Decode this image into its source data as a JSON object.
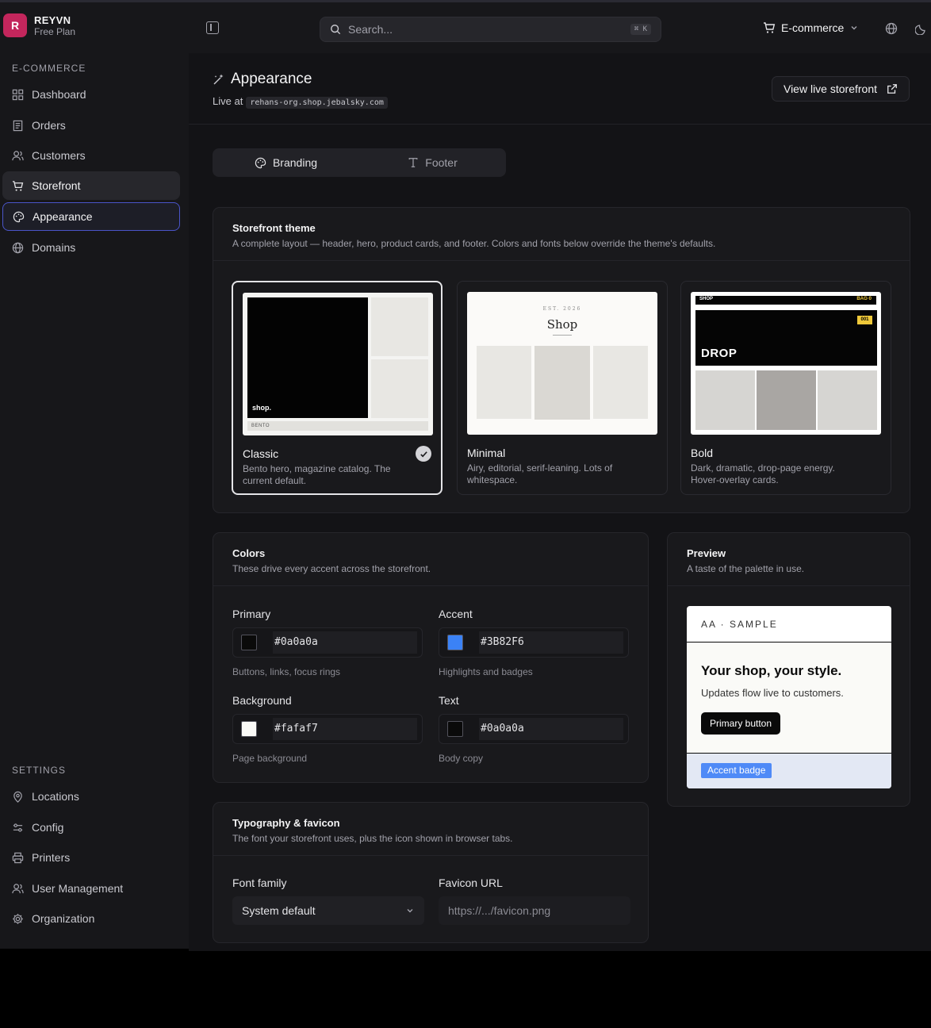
{
  "brand": {
    "initial": "R",
    "name": "REYVN",
    "plan": "Free Plan"
  },
  "search": {
    "placeholder": "Search...",
    "shortcut": "⌘ K"
  },
  "store_switcher": {
    "label": "E-commerce"
  },
  "sidebar": {
    "section_ecommerce": "E-COMMERCE",
    "ecommerce_items": [
      {
        "label": "Dashboard",
        "icon": "dashboard-icon"
      },
      {
        "label": "Orders",
        "icon": "orders-icon"
      },
      {
        "label": "Customers",
        "icon": "customers-icon"
      },
      {
        "label": "Storefront",
        "icon": "cart-icon"
      },
      {
        "label": "Appearance",
        "icon": "palette-icon"
      },
      {
        "label": "Domains",
        "icon": "globe-icon"
      }
    ],
    "section_settings": "SETTINGS",
    "settings_items": [
      {
        "label": "Locations",
        "icon": "map-pin-icon"
      },
      {
        "label": "Config",
        "icon": "sliders-icon"
      },
      {
        "label": "Printers",
        "icon": "printer-icon"
      },
      {
        "label": "User Management",
        "icon": "users-icon"
      },
      {
        "label": "Organization",
        "icon": "gear-icon"
      }
    ]
  },
  "page": {
    "title": "Appearance",
    "live_prefix": "Live at",
    "live_url": "rehans-org.shop.jebalsky.com",
    "view_live_label": "View live storefront"
  },
  "tabs": [
    {
      "label": "Branding",
      "active": true
    },
    {
      "label": "Footer",
      "active": false
    }
  ],
  "theme_section": {
    "title": "Storefront theme",
    "subtitle": "A complete layout — header, hero, product cards, and footer. Colors and fonts below override the theme's defaults.",
    "themes": [
      {
        "name": "Classic",
        "desc": "Bento hero, magazine catalog. The current default.",
        "selected": true,
        "preview_text": "shop.",
        "preview_footer": "BENTO"
      },
      {
        "name": "Minimal",
        "desc": "Airy, editorial, serif-leaning. Lots of whitespace.",
        "selected": false,
        "preview_est": "EST. 2026",
        "preview_title": "Shop"
      },
      {
        "name": "Bold",
        "desc": "Dark, dramatic, drop-page energy. Hover-overlay cards.",
        "selected": false,
        "preview_shop": "SHOP",
        "preview_bag": "BAG·0",
        "preview_badge": "001",
        "preview_title": "DROP"
      }
    ]
  },
  "colors": {
    "title": "Colors",
    "subtitle": "These drive every accent across the storefront.",
    "fields": [
      {
        "label": "Primary",
        "value": "#0a0a0a",
        "hint": "Buttons, links, focus rings",
        "swatch": "#0a0a0a"
      },
      {
        "label": "Accent",
        "value": "#3B82F6",
        "hint": "Highlights and badges",
        "swatch": "#3B82F6"
      },
      {
        "label": "Background",
        "value": "#fafaf7",
        "hint": "Page background",
        "swatch": "#fafaf7"
      },
      {
        "label": "Text",
        "value": "#0a0a0a",
        "hint": "Body copy",
        "swatch": "#0a0a0a"
      }
    ]
  },
  "preview": {
    "title": "Preview",
    "subtitle": "A taste of the palette in use.",
    "sample_label": "AA · SAMPLE",
    "headline": "Your shop, your style.",
    "body": "Updates flow live to customers.",
    "button": "Primary button",
    "badge": "Accent badge"
  },
  "typography": {
    "title": "Typography & favicon",
    "subtitle": "The font your storefront uses, plus the icon shown in browser tabs.",
    "font_label": "Font family",
    "font_value": "System default",
    "favicon_label": "Favicon URL",
    "favicon_placeholder": "https://.../favicon.png"
  }
}
